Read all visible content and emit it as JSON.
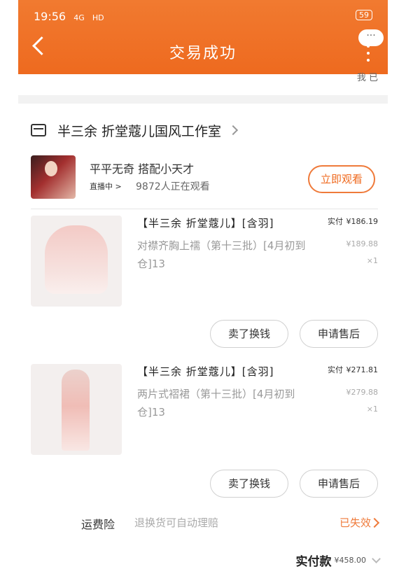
{
  "status_bar": {
    "time": "19:56",
    "signal": "4G",
    "network": "HD",
    "battery": "59"
  },
  "header": {
    "title": "交易成功",
    "more_label": "···"
  },
  "clipped_text": "我 已",
  "shop": {
    "name": "半三余 折堂蔻儿国风工作室"
  },
  "live": {
    "host": "平平无奇 搭配小天才",
    "status": "直播中 >",
    "viewers": "9872人正在观看",
    "watch_label": "立即观看"
  },
  "products": [
    {
      "title": "【半三余 折堂蔻儿】[含羽]",
      "subtitle": "对襟齐胸上襦（第十三批）[4月初到仓]13",
      "paid": "实付",
      "paid_amount": "¥186.19",
      "original_price": "¥189.88",
      "quantity": "×1"
    },
    {
      "title": "【半三余 折堂蔻儿】[含羽]",
      "subtitle": "两片式褶裙（第十三批）[4月初到仓]13",
      "paid": "实付",
      "paid_amount": "¥271.81",
      "original_price": "¥279.88",
      "quantity": "×1"
    }
  ],
  "buttons": {
    "sell": "卖了换钱",
    "after_sale": "申请售后"
  },
  "insurance": {
    "label": "运费险",
    "description": "退换货可自动理赔",
    "status": "已失效"
  },
  "total": {
    "label": "实付款",
    "amount": "¥458.00"
  },
  "colors": {
    "accent": "#ee6a1f",
    "header_bg": "#f17a30"
  }
}
